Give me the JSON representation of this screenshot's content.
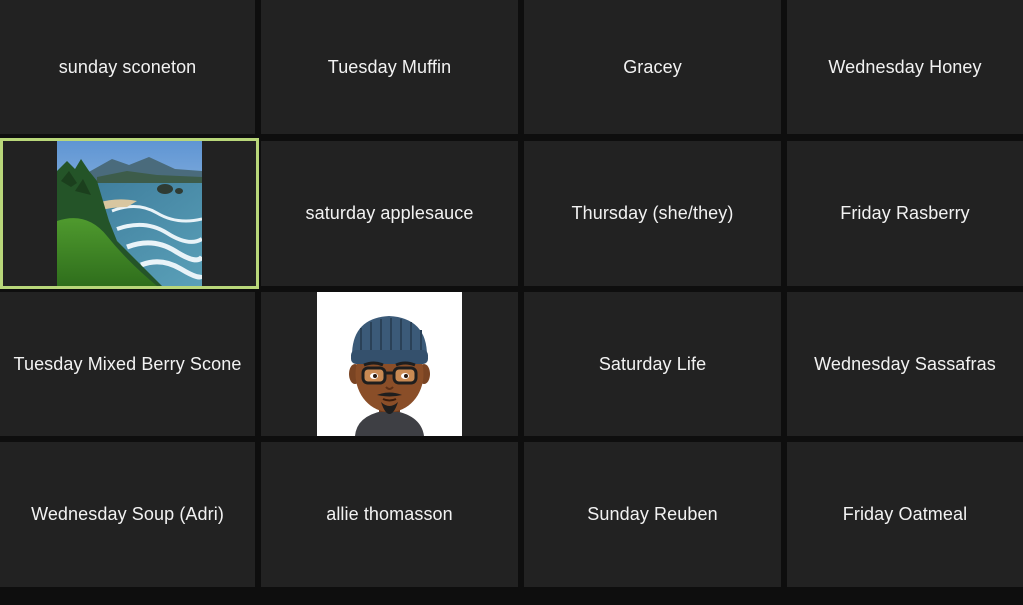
{
  "participants": [
    {
      "name": "sunday sconeton"
    },
    {
      "name": "Tuesday Muffin"
    },
    {
      "name": "Gracey"
    },
    {
      "name": "Wednesday Honey"
    },
    {
      "name": "",
      "video": "landscape-coast"
    },
    {
      "name": "saturday applesauce"
    },
    {
      "name": "Thursday (she/they)"
    },
    {
      "name": "Friday Rasberry"
    },
    {
      "name": "Tuesday Mixed Berry Scone"
    },
    {
      "name": "",
      "video": "cartoon-avatar"
    },
    {
      "name": "Saturday Life"
    },
    {
      "name": "Wednesday Sassafras"
    },
    {
      "name": "Wednesday Soup (Adri)"
    },
    {
      "name": "allie thomasson"
    },
    {
      "name": "Sunday Reuben"
    },
    {
      "name": "Friday Oatmeal"
    }
  ],
  "colors": {
    "background": "#0e0e0e",
    "tile": "#222222",
    "active_speaker_border": "#b9d77a",
    "name_text": "#f2f2f2"
  }
}
